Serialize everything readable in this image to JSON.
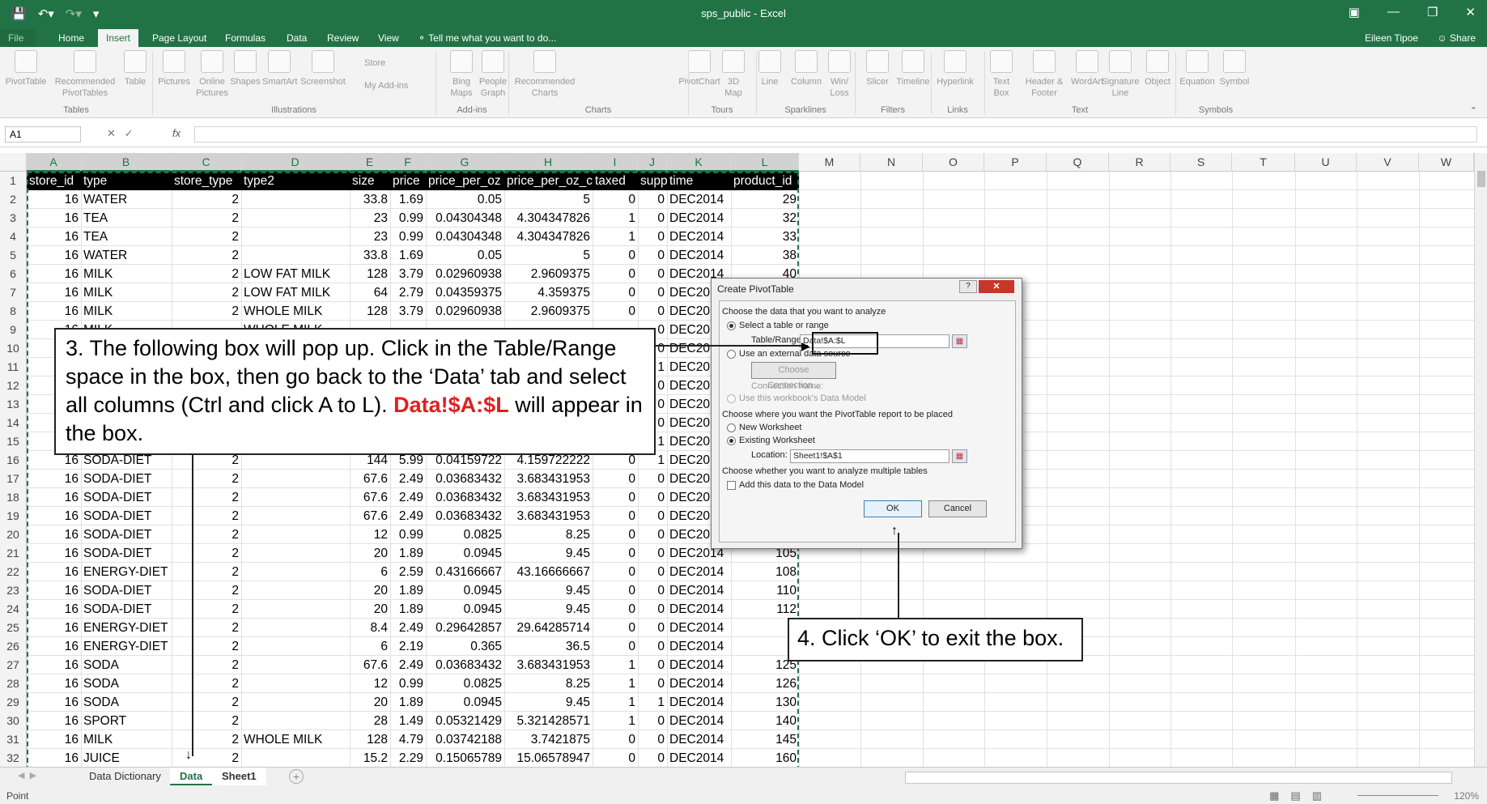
{
  "window": {
    "title": "sps_public - Excel",
    "user": "Eileen Tipoe",
    "share": "Share",
    "qat": [
      "save-icon",
      "undo-icon",
      "redo-icon",
      "customize-icon"
    ]
  },
  "ribbon_tabs": [
    "File",
    "Home",
    "Insert",
    "Page Layout",
    "Formulas",
    "Data",
    "Review",
    "View"
  ],
  "active_tab": "Insert",
  "tell_me": "Tell me what you want to do...",
  "ribbon": {
    "buttons": [
      {
        "label": "PivotTable",
        "icon": "pivottable-icon"
      },
      {
        "label": "Recommended PivotTables",
        "icon": "recommended-pivottables-icon"
      },
      {
        "label": "Table",
        "icon": "table-icon"
      },
      {
        "label": "Pictures",
        "icon": "pictures-icon"
      },
      {
        "label": "Online Pictures",
        "icon": "online-pictures-icon"
      },
      {
        "label": "Shapes",
        "icon": "shapes-icon"
      },
      {
        "label": "SmartArt",
        "icon": "smartart-icon"
      },
      {
        "label": "Screenshot",
        "icon": "screenshot-icon"
      },
      {
        "label": "Bing Maps",
        "icon": "bing-maps-icon"
      },
      {
        "label": "People Graph",
        "icon": "people-graph-icon"
      },
      {
        "label": "Recommended Charts",
        "icon": "recommended-charts-icon"
      },
      {
        "label": "PivotChart",
        "icon": "pivotchart-icon"
      },
      {
        "label": "3D Map",
        "icon": "3d-map-icon"
      },
      {
        "label": "Line",
        "icon": "line-sparkline-icon"
      },
      {
        "label": "Column",
        "icon": "column-sparkline-icon"
      },
      {
        "label": "Win/ Loss",
        "icon": "winloss-sparkline-icon"
      },
      {
        "label": "Slicer",
        "icon": "slicer-icon"
      },
      {
        "label": "Timeline",
        "icon": "timeline-icon"
      },
      {
        "label": "Hyperlink",
        "icon": "hyperlink-icon"
      },
      {
        "label": "Text Box",
        "icon": "textbox-icon"
      },
      {
        "label": "Header & Footer",
        "icon": "header-footer-icon"
      },
      {
        "label": "WordArt",
        "icon": "wordart-icon"
      },
      {
        "label": "Signature Line",
        "icon": "signature-line-icon"
      },
      {
        "label": "Object",
        "icon": "object-icon"
      },
      {
        "label": "Equation",
        "icon": "equation-icon"
      },
      {
        "label": "Symbol",
        "icon": "symbol-icon"
      }
    ],
    "small": {
      "store": "Store",
      "addins": "My Add-ins"
    },
    "groups": [
      "Tables",
      "Illustrations",
      "Add-ins",
      "Charts",
      "Tours",
      "Sparklines",
      "Filters",
      "Links",
      "Text",
      "Symbols"
    ]
  },
  "formula_bar": {
    "namebox": "A1",
    "fx": "fx",
    "value": ""
  },
  "columns": [
    "A",
    "B",
    "C",
    "D",
    "E",
    "F",
    "G",
    "H",
    "I",
    "J",
    "K",
    "L",
    "M",
    "N",
    "O",
    "P",
    "Q",
    "R",
    "S",
    "T",
    "U",
    "V",
    "W"
  ],
  "header_row": [
    "store_id",
    "type",
    "store_type",
    "type2",
    "size",
    "price",
    "price_per_oz",
    "price_per_oz_c",
    "taxed",
    "supp",
    "time",
    "product_id"
  ],
  "rows": [
    [
      "16",
      "WATER",
      "2",
      "",
      "33.8",
      "1.69",
      "0.05",
      "5",
      "0",
      "0",
      "DEC2014",
      "29"
    ],
    [
      "16",
      "TEA",
      "2",
      "",
      "23",
      "0.99",
      "0.04304348",
      "4.304347826",
      "1",
      "0",
      "DEC2014",
      "32"
    ],
    [
      "16",
      "TEA",
      "2",
      "",
      "23",
      "0.99",
      "0.04304348",
      "4.304347826",
      "1",
      "0",
      "DEC2014",
      "33"
    ],
    [
      "16",
      "WATER",
      "2",
      "",
      "33.8",
      "1.69",
      "0.05",
      "5",
      "0",
      "0",
      "DEC2014",
      "38"
    ],
    [
      "16",
      "MILK",
      "2",
      "LOW FAT MILK",
      "128",
      "3.79",
      "0.02960938",
      "2.9609375",
      "0",
      "0",
      "DEC2014",
      "40"
    ],
    [
      "16",
      "MILK",
      "2",
      "LOW FAT MILK",
      "64",
      "2.79",
      "0.04359375",
      "4.359375",
      "0",
      "0",
      "DEC20",
      ""
    ],
    [
      "16",
      "MILK",
      "2",
      "WHOLE MILK",
      "128",
      "3.79",
      "0.02960938",
      "2.9609375",
      "0",
      "0",
      "DEC20",
      ""
    ],
    [
      "",
      "",
      "",
      "",
      "",
      "",
      "",
      "",
      "",
      "0",
      "DEC20",
      ""
    ],
    [
      "",
      "",
      "",
      "",
      "",
      "",
      "",
      "",
      "",
      "0",
      "DEC20",
      ""
    ],
    [
      "",
      "",
      "",
      "",
      "",
      "",
      "",
      "",
      "",
      "1",
      "DEC20",
      ""
    ],
    [
      "",
      "",
      "",
      "",
      "",
      "",
      "",
      "",
      "",
      "0",
      "DEC20",
      ""
    ],
    [
      "",
      "",
      "",
      "",
      "",
      "",
      "",
      "",
      "",
      "0",
      "DEC20",
      ""
    ],
    [
      "",
      "",
      "",
      "",
      "",
      "",
      "",
      "",
      "",
      "0",
      "DEC20",
      ""
    ],
    [
      "",
      "",
      "",
      "",
      "",
      "",
      "",
      "",
      "",
      "1",
      "DEC20",
      ""
    ],
    [
      "16",
      "SODA-DIET",
      "2",
      "",
      "144",
      "5.99",
      "0.04159722",
      "4.159722222",
      "0",
      "1",
      "DEC20",
      ""
    ],
    [
      "16",
      "SODA-DIET",
      "2",
      "",
      "67.6",
      "2.49",
      "0.03683432",
      "3.683431953",
      "0",
      "0",
      "DEC20",
      ""
    ],
    [
      "16",
      "SODA-DIET",
      "2",
      "",
      "67.6",
      "2.49",
      "0.03683432",
      "3.683431953",
      "0",
      "0",
      "DEC20",
      ""
    ],
    [
      "16",
      "SODA-DIET",
      "2",
      "",
      "67.6",
      "2.49",
      "0.03683432",
      "3.683431953",
      "0",
      "0",
      "DEC20",
      ""
    ],
    [
      "16",
      "SODA-DIET",
      "2",
      "",
      "12",
      "0.99",
      "0.0825",
      "8.25",
      "0",
      "0",
      "DEC20",
      ""
    ],
    [
      "16",
      "SODA-DIET",
      "2",
      "",
      "20",
      "1.89",
      "0.0945",
      "9.45",
      "0",
      "0",
      "DEC2014",
      "105"
    ],
    [
      "16",
      "ENERGY-DIET",
      "2",
      "",
      "6",
      "2.59",
      "0.43166667",
      "43.16666667",
      "0",
      "0",
      "DEC2014",
      "108"
    ],
    [
      "16",
      "SODA-DIET",
      "2",
      "",
      "20",
      "1.89",
      "0.0945",
      "9.45",
      "0",
      "0",
      "DEC2014",
      "110"
    ],
    [
      "16",
      "SODA-DIET",
      "2",
      "",
      "20",
      "1.89",
      "0.0945",
      "9.45",
      "0",
      "0",
      "DEC2014",
      "112"
    ],
    [
      "16",
      "ENERGY-DIET",
      "2",
      "",
      "8.4",
      "2.49",
      "0.29642857",
      "29.64285714",
      "0",
      "0",
      "DEC2014",
      "1"
    ],
    [
      "16",
      "ENERGY-DIET",
      "2",
      "",
      "6",
      "2.19",
      "0.365",
      "36.5",
      "0",
      "0",
      "DEC2014",
      "1"
    ],
    [
      "16",
      "SODA",
      "2",
      "",
      "67.6",
      "2.49",
      "0.03683432",
      "3.683431953",
      "1",
      "0",
      "DEC2014",
      "125"
    ],
    [
      "16",
      "SODA",
      "2",
      "",
      "12",
      "0.99",
      "0.0825",
      "8.25",
      "1",
      "0",
      "DEC2014",
      "126"
    ],
    [
      "16",
      "SODA",
      "2",
      "",
      "20",
      "1.89",
      "0.0945",
      "9.45",
      "1",
      "1",
      "DEC2014",
      "130"
    ],
    [
      "16",
      "SPORT",
      "2",
      "",
      "28",
      "1.49",
      "0.05321429",
      "5.321428571",
      "1",
      "0",
      "DEC2014",
      "140"
    ],
    [
      "16",
      "MILK",
      "2",
      "WHOLE MILK",
      "128",
      "4.79",
      "0.03742188",
      "3.7421875",
      "0",
      "0",
      "DEC2014",
      "145"
    ],
    [
      "16",
      "JUICE",
      "2",
      "",
      "15.2",
      "2.29",
      "0.15065789",
      "15.06578947",
      "0",
      "0",
      "DEC2014",
      "160"
    ]
  ],
  "row9_partial": {
    "a": "16",
    "b": "MILK",
    "d": "WHOLE MILK"
  },
  "sheets": [
    "Data Dictionary",
    "Data",
    "Sheet1"
  ],
  "active_sheet": "Data",
  "status": {
    "mode": "Point",
    "zoom": "120%"
  },
  "dialog": {
    "title": "Create PivotTable",
    "help": "?",
    "close": "✕",
    "section1": "Choose the data that you want to analyze",
    "opt_select": "Select a table or range",
    "range_label": "Table/Range:",
    "range_value": "Data!$A:$L",
    "opt_external": "Use an external data source",
    "choose_connection": "Choose Connection...",
    "connection_name": "Connection name:",
    "opt_datamodel": "Use this workbook's Data Model",
    "section2": "Choose where you want the PivotTable report to be placed",
    "opt_new": "New Worksheet",
    "opt_existing": "Existing Worksheet",
    "location_label": "Location:",
    "location_value": "Sheet1!$A$1",
    "section3": "Choose whether you want to analyze multiple tables",
    "add_datamodel": "Add this data to the Data Model",
    "ok": "OK",
    "cancel": "Cancel"
  },
  "annotations": {
    "step3_a": "3. The following box will pop up. Click in the Table/Range space in the box, then go back to the ‘Data’ tab and select all columns (Ctrl and click A to L). ",
    "step3_red": "Data!$A:$L",
    "step3_b": " will appear in the box.",
    "step4": "4. Click ‘OK’ to exit the box."
  },
  "colors": {
    "excel_green": "#217346",
    "annotation_red": "#e02020"
  }
}
